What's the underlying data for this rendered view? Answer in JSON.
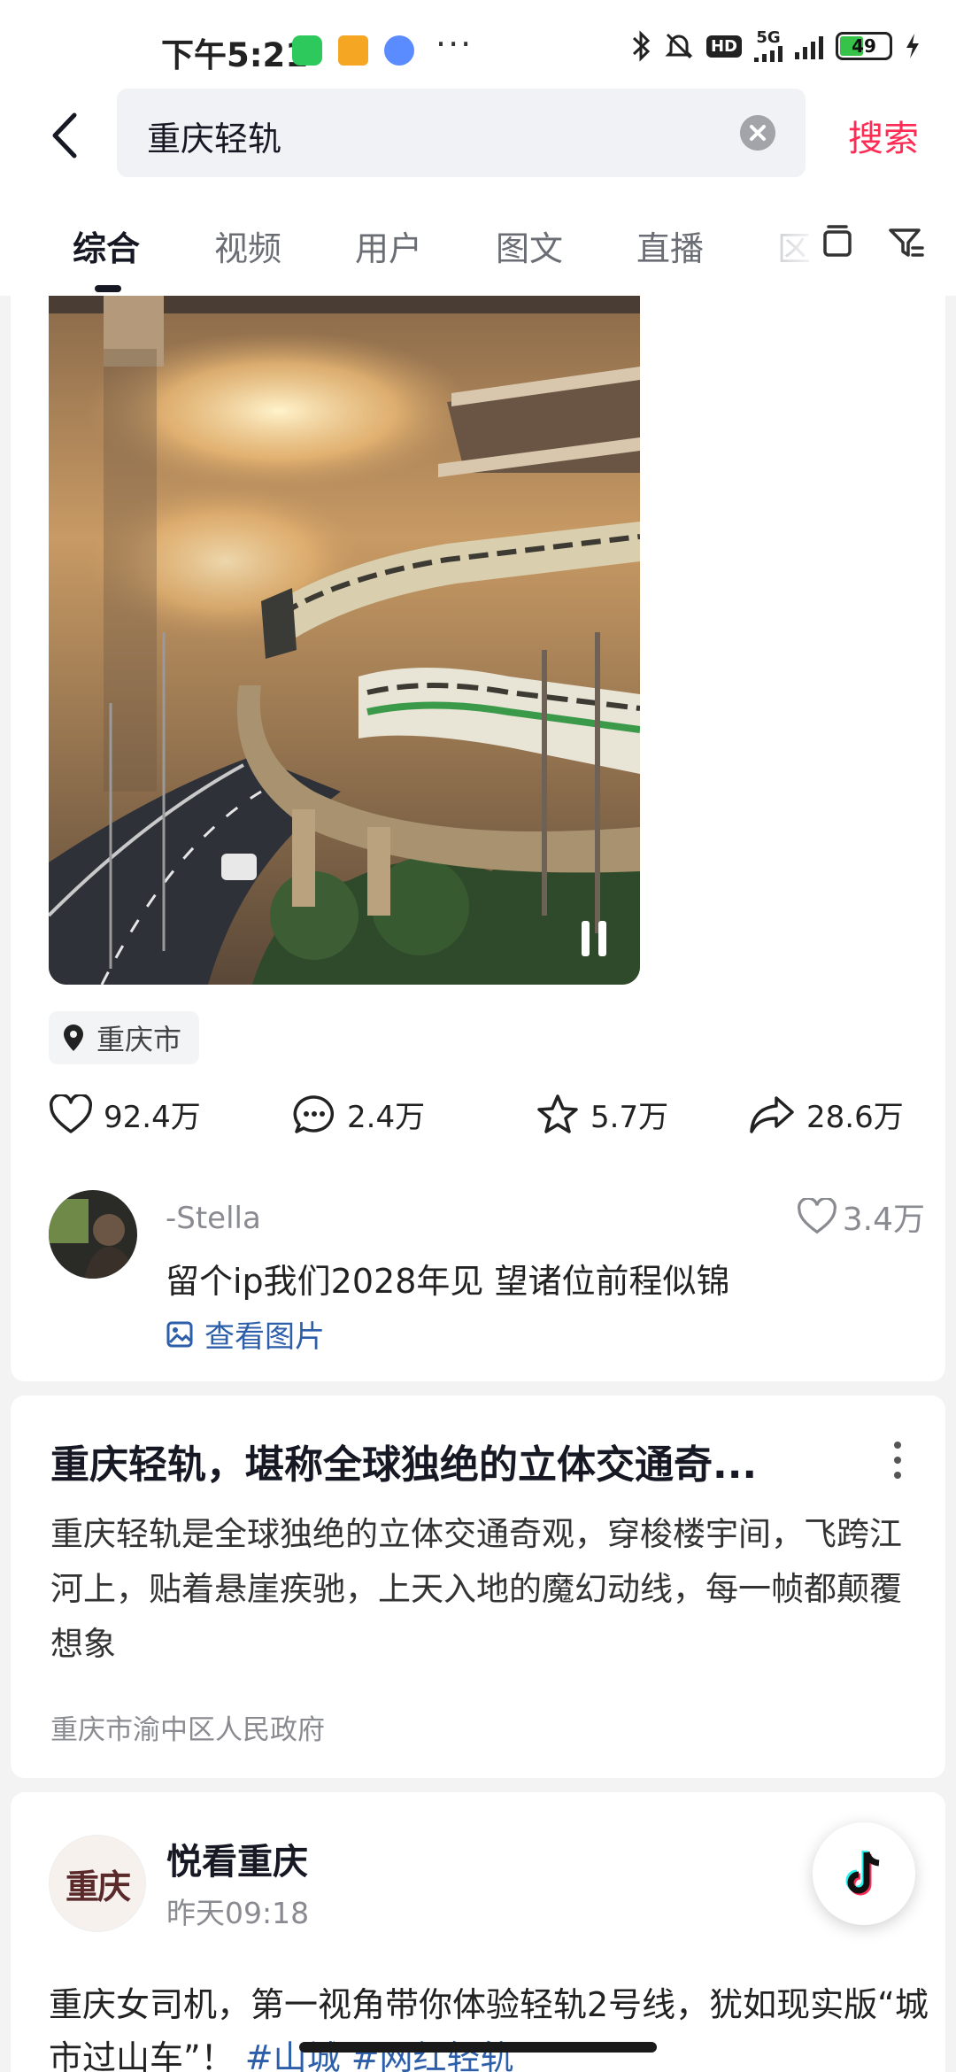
{
  "status_bar": {
    "time": "下午5:21",
    "more": "···",
    "hd_badge": "HD",
    "network": "5G",
    "battery": "49",
    "battery_level": 0.49
  },
  "search": {
    "query": "重庆轻轨",
    "button": "搜索"
  },
  "tabs": [
    {
      "label": "综合",
      "active": true
    },
    {
      "label": "视频"
    },
    {
      "label": "用户"
    },
    {
      "label": "图文"
    },
    {
      "label": "直播"
    },
    {
      "label": "区"
    }
  ],
  "post": {
    "location": "重庆市",
    "likes": "92.4万",
    "comments": "2.4万",
    "favorites": "5.7万",
    "shares": "28.6万",
    "top_comment": {
      "user": "-Stella",
      "likes": "3.4万",
      "text": "留个ip我们2028年见 望诸位前程似锦",
      "view_image": "查看图片"
    }
  },
  "article": {
    "title": "重庆轻轨，堪称全球独绝的立体交通奇...",
    "description": "重庆轻轨是全球独绝的立体交通奇观，穿梭楼宇间，飞跨江河上，贴着悬崖疾驰，上天入地的魔幻动线，每一帧都颠覆想象",
    "source": "重庆市渝中区人民政府"
  },
  "next_post": {
    "avatar_text": "重庆",
    "author": "悦看重庆",
    "time": "昨天09:18",
    "text": "重庆女司机，第一视角带你体验轻轨2号线，犹如现实版“城市过山车”！",
    "tags": "#山城 #网红轻轨"
  },
  "colors": {
    "accent": "#fe2c55",
    "link": "#2d5ea9",
    "background": "#f3f3f4"
  }
}
